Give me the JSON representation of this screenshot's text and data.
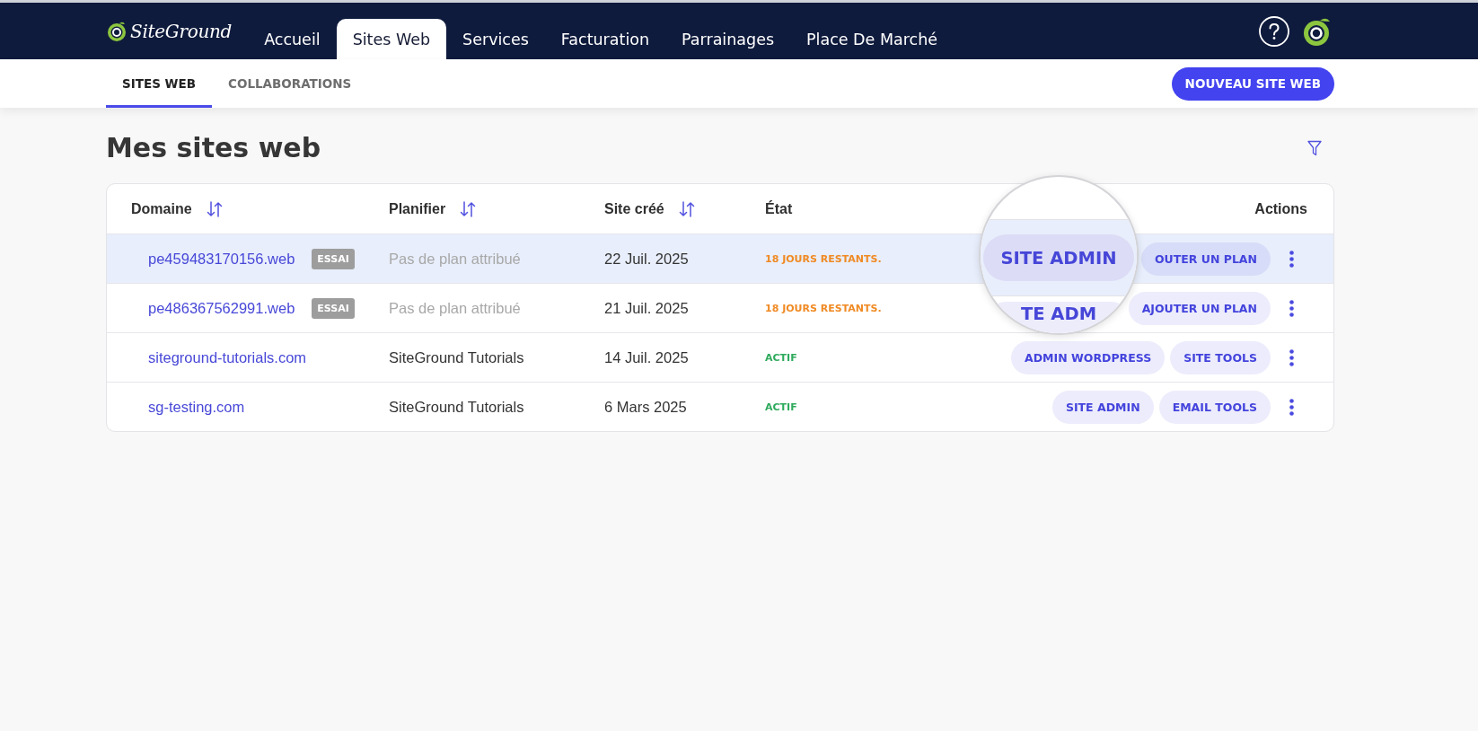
{
  "top_nav": {
    "logo": "SiteGround",
    "tabs": [
      {
        "label": "Accueil",
        "selected": false
      },
      {
        "label": "Sites Web",
        "selected": true
      },
      {
        "label": "Services",
        "selected": false
      },
      {
        "label": "Facturation",
        "selected": false
      },
      {
        "label": "Parrainages",
        "selected": false
      },
      {
        "label": "Place De Marché",
        "selected": false
      }
    ]
  },
  "sub_nav": {
    "tabs": [
      {
        "label": "SITES WEB",
        "selected": true
      },
      {
        "label": "COLLABORATIONS",
        "selected": false
      }
    ],
    "primary_button": "NOUVEAU SITE WEB"
  },
  "page": {
    "title": "Mes sites web"
  },
  "table": {
    "columns": [
      {
        "label": "Domaine",
        "sortable": true
      },
      {
        "label": "Planifier",
        "sortable": true
      },
      {
        "label": "Site créé",
        "sortable": true
      },
      {
        "label": "État",
        "sortable": false
      },
      {
        "label": "Actions",
        "sortable": false
      }
    ],
    "rows": [
      {
        "domain": "pe459483170156.web",
        "badge": "ESSAI",
        "plan": "Pas de plan attribué",
        "plan_assigned": false,
        "created": "22 Juil. 2025",
        "status": {
          "label": "18 JOURS RESTANTS.",
          "kind": "trial"
        },
        "highlighted": true,
        "actions": [
          "OUTER UN PLAN"
        ]
      },
      {
        "domain": "pe486367562991.web",
        "badge": "ESSAI",
        "plan": "Pas de plan attribué",
        "plan_assigned": false,
        "created": "21 Juil. 2025",
        "status": {
          "label": "18 JOURS RESTANTS.",
          "kind": "trial"
        },
        "highlighted": false,
        "actions": [
          "AJOUTER UN PLAN"
        ]
      },
      {
        "domain": "siteground-tutorials.com",
        "plan": "SiteGround Tutorials",
        "plan_assigned": true,
        "created": "14 Juil. 2025",
        "status": {
          "label": "ACTIF",
          "kind": "active"
        },
        "highlighted": false,
        "actions": [
          "ADMIN WORDPRESS",
          "SITE TOOLS"
        ]
      },
      {
        "domain": "sg-testing.com",
        "plan": "SiteGround Tutorials",
        "plan_assigned": true,
        "created": "6 Mars 2025",
        "status": {
          "label": "ACTIF",
          "kind": "active"
        },
        "highlighted": false,
        "actions": [
          "SITE ADMIN",
          "EMAIL TOOLS"
        ]
      }
    ]
  },
  "magnifier": {
    "focus_label": "SITE ADMIN",
    "partial_label": "TE ADM"
  }
}
